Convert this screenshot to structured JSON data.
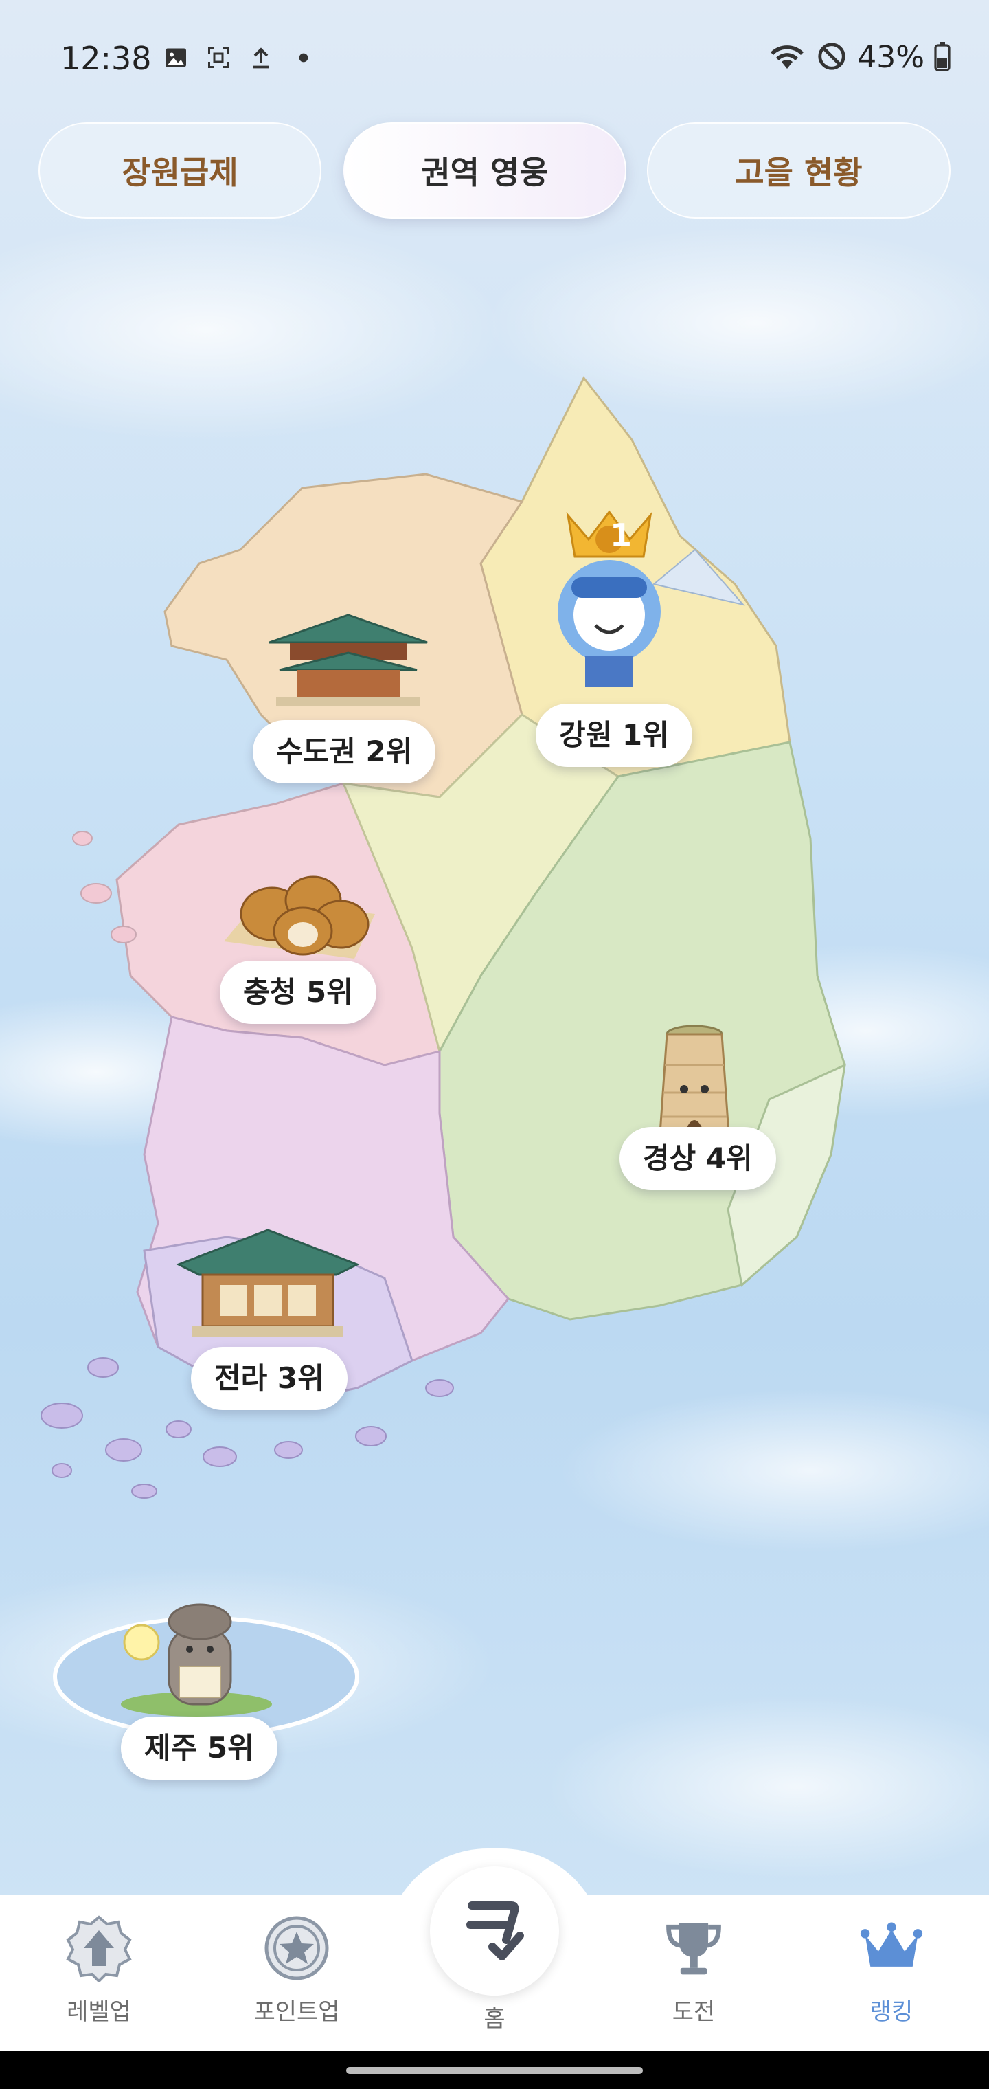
{
  "status_bar": {
    "time": "12:38",
    "battery": "43%",
    "left_icons": [
      "image-icon",
      "screenshot-icon",
      "upload-icon",
      "dot-icon"
    ],
    "right_icons": [
      "wifi-icon",
      "do-not-disturb-icon",
      "battery-icon"
    ]
  },
  "tabs": [
    {
      "label": "장원급제",
      "active": false
    },
    {
      "label": "권역 영웅",
      "active": true
    },
    {
      "label": "고을 현황",
      "active": false
    }
  ],
  "regions": [
    {
      "label": "수도권 2위",
      "icon": "palace-icon"
    },
    {
      "label": "강원 1위",
      "icon": "snow-hero-icon",
      "crown_rank": "1"
    },
    {
      "label": "충청 5위",
      "icon": "walnut-cookie-icon"
    },
    {
      "label": "경상 4위",
      "icon": "tower-icon"
    },
    {
      "label": "전라 3위",
      "icon": "hanok-icon"
    },
    {
      "label": "제주 5위",
      "icon": "stone-grandpa-icon"
    }
  ],
  "bottom_nav": {
    "items": [
      {
        "label": "레벨업",
        "icon": "level-up-icon",
        "active": false
      },
      {
        "label": "포인트업",
        "icon": "star-badge-icon",
        "active": false
      },
      {
        "label": "홈",
        "icon": "home-logo-icon",
        "active": false
      },
      {
        "label": "도전",
        "icon": "trophy-icon",
        "active": false
      },
      {
        "label": "랭킹",
        "icon": "crown-icon",
        "active": true
      }
    ],
    "active_color": "#5c8fd6"
  },
  "colors": {
    "tab_text": "#8a5a2b",
    "active_tab_text": "#2c2c2c",
    "sea": "#c9e1f5"
  }
}
